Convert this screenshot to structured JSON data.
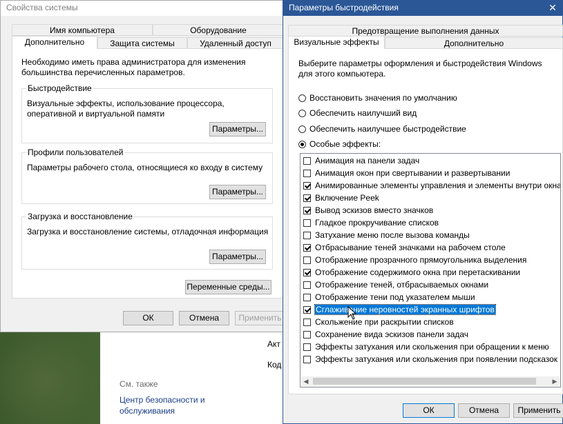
{
  "sys_window": {
    "title": "Свойства системы",
    "tabs_top": [
      "Имя компьютера",
      "Оборудование"
    ],
    "tabs_bottom": [
      "Дополнительно",
      "Защита системы",
      "Удаленный доступ"
    ],
    "admin_note": "Необходимо иметь права администратора для изменения большинства перечисленных параметров.",
    "groups": {
      "performance": {
        "label": "Быстродействие",
        "text": "Визуальные эффекты, использование процессора, оперативной и виртуальной памяти",
        "button": "Параметры..."
      },
      "profiles": {
        "label": "Профили пользователей",
        "text": "Параметры рабочего стола, относящиеся ко входу в систему",
        "button": "Параметры..."
      },
      "startup": {
        "label": "Загрузка и восстановление",
        "text": "Загрузка и восстановление системы, отладочная информация",
        "button": "Параметры..."
      }
    },
    "env_button": "Переменные среды...",
    "ok": "ОК",
    "cancel": "Отмена",
    "apply": "Применить"
  },
  "perf_window": {
    "title": "Параметры быстродействия",
    "close": "✕",
    "tab_top": "Предотвращение выполнения данных",
    "tabs": [
      "Визуальные эффекты",
      "Дополнительно"
    ],
    "intro": "Выберите параметры оформления и быстродействия Windows для этого компьютера.",
    "radios": [
      {
        "label": "Восстановить значения по умолчанию",
        "checked": false
      },
      {
        "label": "Обеспечить наилучший вид",
        "checked": false
      },
      {
        "label": "Обеспечить наилучшее быстродействие",
        "checked": false
      },
      {
        "label": "Особые эффекты:",
        "checked": true
      }
    ],
    "effects": [
      {
        "label": "Анимация на панели задач",
        "checked": false
      },
      {
        "label": "Анимация окон при свертывании и развертывании",
        "checked": false
      },
      {
        "label": "Анимированные элементы управления и элементы внутри окна",
        "checked": true
      },
      {
        "label": "Включение Peek",
        "checked": true
      },
      {
        "label": "Вывод эскизов вместо значков",
        "checked": true
      },
      {
        "label": "Гладкое прокручивание списков",
        "checked": false
      },
      {
        "label": "Затухание меню после вызова команды",
        "checked": false
      },
      {
        "label": "Отбрасывание теней значками на рабочем столе",
        "checked": true
      },
      {
        "label": "Отображение прозрачного прямоугольника выделения",
        "checked": false
      },
      {
        "label": "Отображение содержимого окна при перетаскивании",
        "checked": true
      },
      {
        "label": "Отображение теней, отбрасываемых окнами",
        "checked": false
      },
      {
        "label": "Отображение тени под указателем мыши",
        "checked": false
      },
      {
        "label": "Сглаживание неровностей экранных шрифтов",
        "checked": true,
        "highlighted": true
      },
      {
        "label": "Скольжение при раскрытии списков",
        "checked": false
      },
      {
        "label": "Сохранение вида эскизов панели задач",
        "checked": false
      },
      {
        "label": "Эффекты затухания или скольжения при обращении к меню",
        "checked": false
      },
      {
        "label": "Эффекты затухания или скольжения при появлении подсказок",
        "checked": false
      }
    ],
    "ok": "ОК",
    "cancel": "Отмена",
    "apply": "Применить"
  },
  "control_panel": {
    "see_also": "См. также",
    "link": "Центр безопасности и обслуживания",
    "frag1": "Акт",
    "frag2": "Код"
  }
}
